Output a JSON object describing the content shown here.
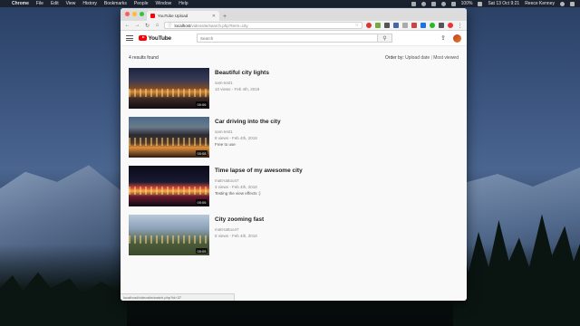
{
  "menubar": {
    "app": "Chrome",
    "items": [
      "File",
      "Edit",
      "View",
      "History",
      "Bookmarks",
      "People",
      "Window",
      "Help"
    ],
    "battery": "100%",
    "datetime": "Sat 13 Oct 9:21",
    "user": "Reece Kenney"
  },
  "browser": {
    "tab_title": "YouTube Upload",
    "url_host": "localhost",
    "url_path": "/videosite/search.php?term=city",
    "status_url": "localhost/videosite/watch.php?id=37"
  },
  "page": {
    "logo_text": "YouTube",
    "search_placeholder": "Search",
    "results_count": "4 results found",
    "order_by_label": "Order by:",
    "order_upload_date": "Upload date",
    "order_separator": "|",
    "order_most_viewed": "Most viewed"
  },
  "results": [
    {
      "title": "Beautiful city lights",
      "uploader": "sam-test1",
      "stats": "10 views - Feb 4th, 2018",
      "description": "",
      "duration": "00:06"
    },
    {
      "title": "Car driving into the city",
      "uploader": "sam-test1",
      "stats": "8 views - Feb 4th, 2018",
      "description": "Free to use",
      "duration": "00:08"
    },
    {
      "title": "Time lapse of my awesome city",
      "uploader": "matt-tattoo47",
      "stats": "3 views - Feb 4th, 2018",
      "description": "Testing the view effects :)",
      "duration": "00:06"
    },
    {
      "title": "City zooming fast",
      "uploader": "matt-tattoo47",
      "stats": "8 views - Feb 4th, 2018",
      "description": "",
      "duration": "00:05"
    }
  ]
}
